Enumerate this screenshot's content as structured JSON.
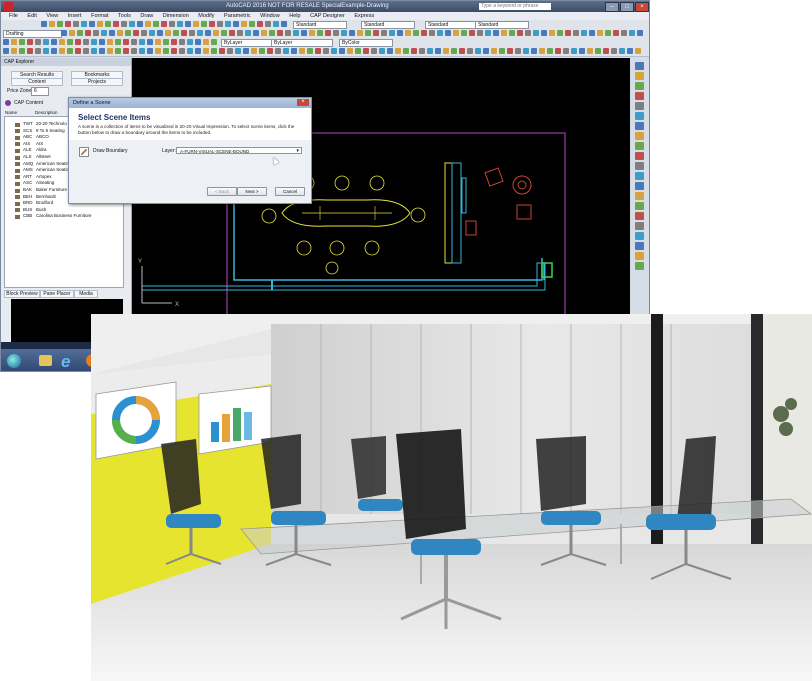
{
  "window": {
    "title": "AutoCAD 2016  NOT FOR RESALE   SpecialExample-Drawing",
    "search_placeholder": "Type a keyword or phrase",
    "menu": [
      "File",
      "Edit",
      "View",
      "Insert",
      "Format",
      "Tools",
      "Draw",
      "Dimension",
      "Modify",
      "Parametric",
      "Window",
      "Help",
      "CAP Designer",
      "Express"
    ]
  },
  "toolbar": {
    "workspace": "Drafting",
    "combos": [
      "Standard",
      "Standard",
      "Standard",
      "Standard",
      "ByLayer",
      "ByLayer",
      "ByColor"
    ]
  },
  "palette": {
    "title": "CAP Explorer",
    "tab_search": "Search Results",
    "tab_bookmarks": "Bookmarks",
    "tab_content": "Content",
    "tab_projects": "Projects",
    "price_zone_label": "Price Zone:",
    "price_zone_value": "6",
    "tree_root": "CAP Content",
    "col_name": "Name",
    "col_description": "Description",
    "rows": [
      {
        "code": "TWT",
        "desc": "20-20 Technolo"
      },
      {
        "code": "SCS",
        "desc": "9 To 5 Seating"
      },
      {
        "code": "ABC",
        "desc": "ABCO"
      },
      {
        "code": "AIS",
        "desc": "AIS"
      },
      {
        "code": "ALE",
        "desc": "Aldra"
      },
      {
        "code": "ALS",
        "desc": "Allsteel"
      },
      {
        "code": "AMQ",
        "desc": "American Seatin"
      },
      {
        "code": "AMS",
        "desc": "American Seatin"
      },
      {
        "code": "ART",
        "desc": "Artopex"
      },
      {
        "code": "ASC",
        "desc": "ASeating"
      },
      {
        "code": "BAK",
        "desc": "Baker Furniture"
      },
      {
        "code": "BEH",
        "desc": "Bernhardt"
      },
      {
        "code": "BRD",
        "desc": "Brodford"
      },
      {
        "code": "BUS",
        "desc": "Bush"
      },
      {
        "code": "CBB",
        "desc": "Carolina Business Furniture"
      }
    ],
    "preview_tabs": [
      "Block Preview",
      "Pane Placer",
      "Media"
    ]
  },
  "dialog": {
    "title": "Define a Scene",
    "heading": "Select Scene Items",
    "description": "A scene is a collection of items to be visualized in 20-20 Visual Impression.  To select scene items, click the button below to draw a boundary around the items to be included.",
    "draw_boundary": "Draw Boundary",
    "layer_label": "Layer:",
    "layer_value": "A-FURN-VISUAL-SCENE-BOUND",
    "back": "< Back",
    "next": "Next >",
    "cancel": "Cancel"
  },
  "colors": {
    "accent": "#1f3768",
    "drawing_bg": "#000000",
    "wall_lines": "#36b9d8",
    "furniture_lines": "#e8e23b",
    "boundary": "#9a3fa5",
    "chair_seat": "#2f86c0",
    "accent_wall": "#e7e42f"
  }
}
